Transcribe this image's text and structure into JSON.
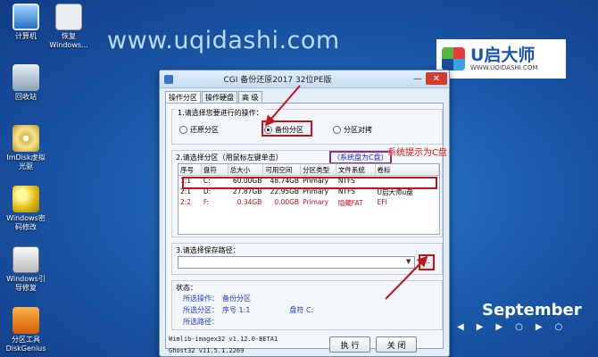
{
  "desktop": {
    "icons": [
      {
        "label": "计算机"
      },
      {
        "label": "恢复\nWindows..."
      },
      {
        "label": "回收站"
      },
      {
        "label": "ImDisk虚拟\n光驱"
      },
      {
        "label": "Windows密\n码修改"
      },
      {
        "label": "Windows引\n导修复"
      },
      {
        "label": "分区工具\nDiskGenius"
      }
    ],
    "watermark": "www.uqidashi.com",
    "logo": {
      "brand": "U启大师",
      "url": "WWW.UQIDASHI.COM"
    },
    "calendar": {
      "month": "September",
      "days": [
        "◀",
        "▶",
        "▶",
        "○",
        "▶",
        "○"
      ]
    }
  },
  "window": {
    "title": "CGI 备份还原2017 32位PE版",
    "minimize_label": "—",
    "close_label": "✕",
    "tabs": [
      {
        "label": "操作分区",
        "active": true
      },
      {
        "label": "操作硬盘",
        "active": false
      },
      {
        "label": "高 级",
        "active": false
      }
    ],
    "section1": {
      "legend": "1.请选择您要进行的操作：",
      "options": [
        "还原分区",
        "备份分区",
        "分区对拷"
      ],
      "selected": "备份分区"
    },
    "section2": {
      "label": "2.请选择分区（用鼠标左键单击）",
      "hint": "（系统盘为C盘）",
      "columns": [
        "序号",
        "盘符",
        "总大小",
        "可用空间",
        "分区类型",
        "文件系统",
        "卷标"
      ],
      "rows": [
        [
          "1:1",
          "C:",
          "60.00GB",
          "48.74GB",
          "Primary",
          "NTFS",
          ""
        ],
        [
          "2:1",
          "D:",
          "27.87GB",
          "22.95GB",
          "Primary",
          "NTFS",
          "U启大师u盘"
        ],
        [
          "2:2",
          "F:",
          "0.34GB",
          "0.00GB",
          "Primary",
          "隐藏FAT",
          "EFI"
        ]
      ]
    },
    "section3": {
      "label": "3.请选择保存路径：",
      "path_value": "",
      "browse_label": "..."
    },
    "section4": {
      "label": "状态：",
      "op_label": "所选操作：",
      "op_value": "备份分区",
      "part_label": "所选分区：",
      "part_value": "序号 1:1",
      "drive_label": "盘符 C:",
      "path_label": "所选路径：",
      "path_value": ""
    },
    "footer": {
      "ver1": "Wimlib-imagex32 v1.12.0-BETA1",
      "ver2": "Ghost32 v11.5.1.2269",
      "run_label": "执 行",
      "close_label": "关 闭"
    }
  },
  "annotation": {
    "text": "系统提示为C盘"
  }
}
